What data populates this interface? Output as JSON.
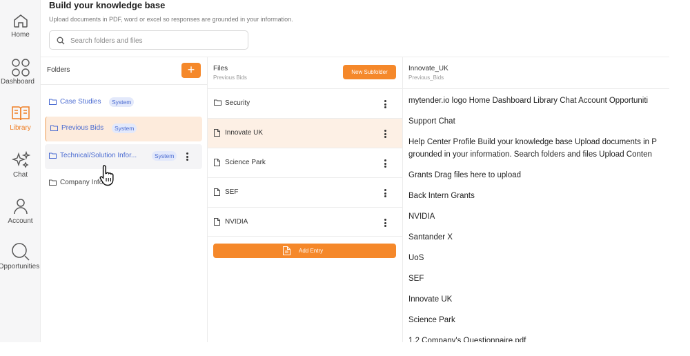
{
  "nav": {
    "items": [
      {
        "label": "Home",
        "icon": "home-icon",
        "active": false
      },
      {
        "label": "Dashboard",
        "icon": "dashboard-icon",
        "active": false
      },
      {
        "label": "Library",
        "icon": "library-icon",
        "active": true
      },
      {
        "label": "Chat",
        "icon": "sparkles-icon",
        "active": false
      },
      {
        "label": "Account",
        "icon": "user-icon",
        "active": false
      },
      {
        "label": "Opportunities",
        "icon": "search-icon",
        "active": false
      }
    ]
  },
  "header": {
    "title": "Build your knowledge base",
    "subtitle": "Upload documents in PDF, word or excel so responses are grounded in your information."
  },
  "search": {
    "placeholder": "Search folders and files"
  },
  "folders": {
    "title": "Folders",
    "add_label": "+",
    "items": [
      {
        "name": "Case Studies",
        "badge": "System"
      },
      {
        "name": "Previous Bids",
        "badge": "System"
      },
      {
        "name": "Technical/Solution Infor...",
        "badge": "System"
      },
      {
        "name": "Company Info",
        "badge": ""
      }
    ]
  },
  "files": {
    "title": "Files",
    "subtitle": "Previous Bids",
    "new_subfolder_label": "New Subfolder",
    "items": [
      {
        "name": "Security",
        "type": "folder"
      },
      {
        "name": "Innovate UK",
        "type": "file"
      },
      {
        "name": "Science Park",
        "type": "file"
      },
      {
        "name": "SEF",
        "type": "file"
      },
      {
        "name": "NVIDIA",
        "type": "file"
      }
    ],
    "add_entry_label": "Add Entry"
  },
  "preview": {
    "title": "Innovate_UK",
    "subtitle": "Previous_Bids",
    "lines": [
      "mytender.io logo Home Dashboard Library Chat Account Opportuniti",
      "Support Chat",
      "Help Center Profile Build your knowledge base Upload documents in P",
      "grounded in your information. Search folders and files Upload Conten",
      "Grants Drag files here to upload",
      "Back Intern Grants",
      "NVIDIA",
      "Santander X",
      "UoS",
      "SEF",
      "Innovate UK",
      "Science Park",
      "1.2 Company's Questionnaire.pdf"
    ]
  },
  "colors": {
    "accent": "#f5882a",
    "link": "#4a6bd1",
    "selected_bg": "#fdebdc"
  }
}
